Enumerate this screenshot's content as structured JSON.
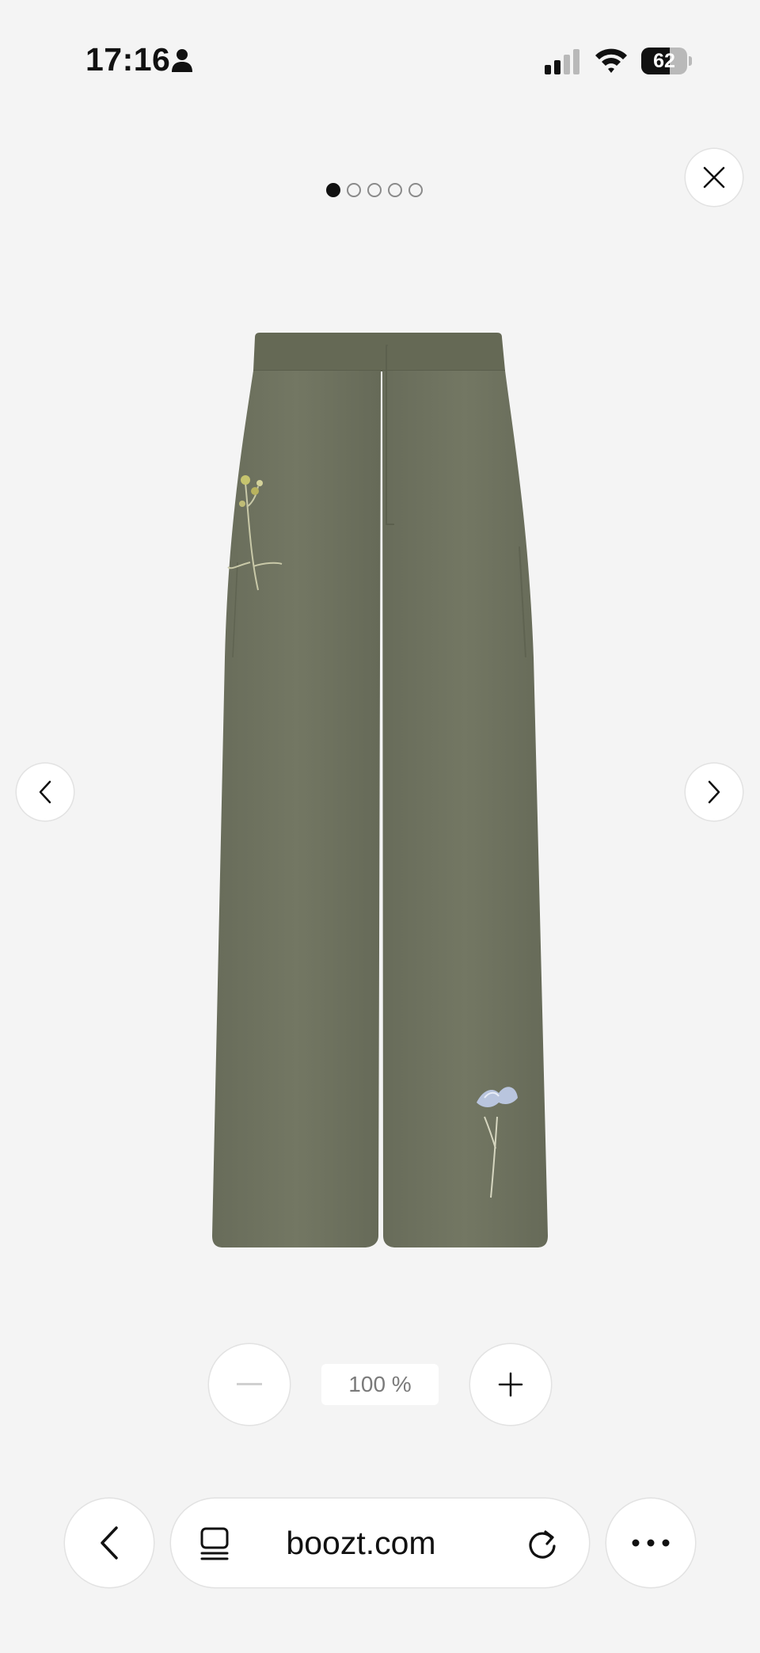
{
  "status_bar": {
    "time": "17:16",
    "battery_level": 62,
    "battery_text": "62"
  },
  "gallery": {
    "total_images": 5,
    "active_index": 0,
    "product_color": "#6f7360"
  },
  "zoom": {
    "level_text": "100 %"
  },
  "browser": {
    "url": "boozt.com"
  },
  "icons": {
    "close": "close-icon",
    "prev": "chevron-left-icon",
    "next": "chevron-right-icon",
    "zoom_out": "minus-icon",
    "zoom_in": "plus-icon",
    "back": "chevron-left-icon",
    "tabs": "tabs-icon",
    "reload": "reload-icon",
    "more": "more-icon"
  }
}
